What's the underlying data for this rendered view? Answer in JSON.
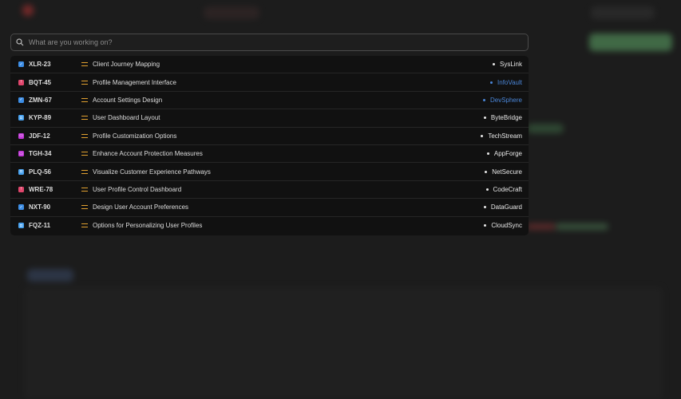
{
  "search": {
    "placeholder": "What are you working on?"
  },
  "colors": {
    "task": "#3d8ee6",
    "bug": "#e0466c",
    "feature": "#c23ad8",
    "story": "#4aa3f0",
    "priority": "#e0a030",
    "link": "#4a86d8"
  },
  "items": [
    {
      "id": "XLR-23",
      "type": "task",
      "title": "Client Journey Mapping",
      "project": "SysLink",
      "highlight": false
    },
    {
      "id": "BQT-45",
      "type": "bug",
      "title": "Profile Management Interface",
      "project": "InfoVault",
      "highlight": true
    },
    {
      "id": "ZMN-67",
      "type": "task",
      "title": "Account Settings Design",
      "project": "DevSphere",
      "highlight": true
    },
    {
      "id": "KYP-89",
      "type": "story",
      "title": "User Dashboard Layout",
      "project": "ByteBridge",
      "highlight": false
    },
    {
      "id": "JDF-12",
      "type": "feature",
      "title": "Profile Customization Options",
      "project": "TechStream",
      "highlight": false
    },
    {
      "id": "TGH-34",
      "type": "feature",
      "title": "Enhance Account Protection Measures",
      "project": "AppForge",
      "highlight": false
    },
    {
      "id": "PLQ-56",
      "type": "story",
      "title": "Visualize Customer Experience Pathways",
      "project": "NetSecure",
      "highlight": false
    },
    {
      "id": "WRE-78",
      "type": "bug",
      "title": "User Profile Control Dashboard",
      "project": "CodeCraft",
      "highlight": false
    },
    {
      "id": "NXT-90",
      "type": "task",
      "title": "Design User Account Preferences",
      "project": "DataGuard",
      "highlight": false
    },
    {
      "id": "FQZ-11",
      "type": "story",
      "title": "Options for Personalizing User Profiles",
      "project": "CloudSync",
      "highlight": false
    }
  ]
}
